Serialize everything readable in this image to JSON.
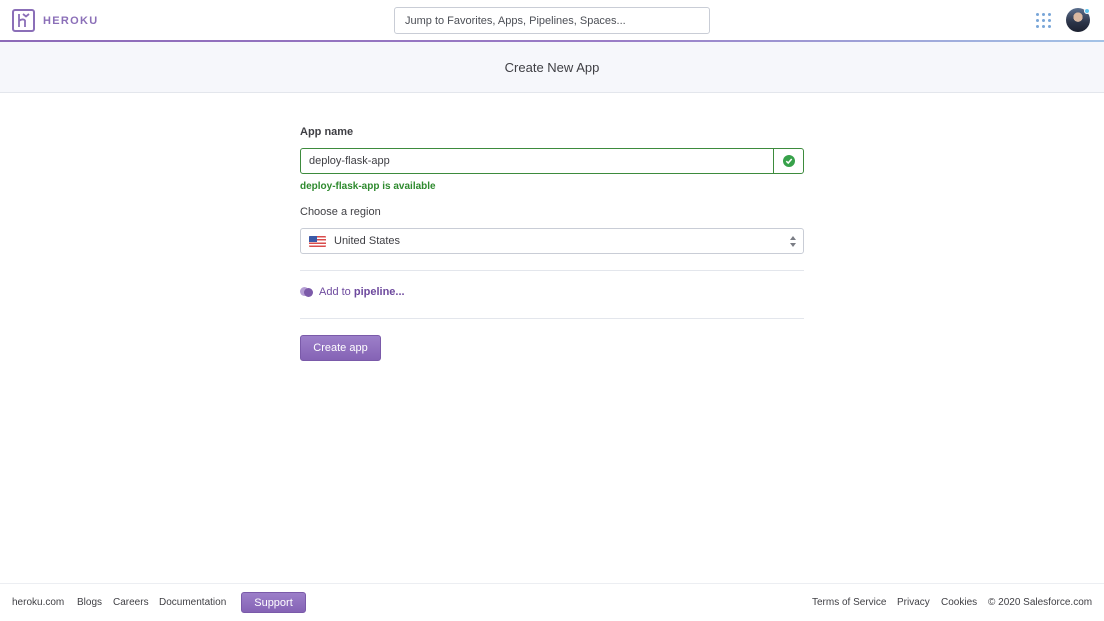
{
  "header": {
    "brand_name": "HEROKU",
    "search_placeholder": "Jump to Favorites, Apps, Pipelines, Spaces..."
  },
  "page": {
    "title": "Create New App"
  },
  "form": {
    "app_name_label": "App name",
    "app_name_value": "deploy-flask-app",
    "availability_message": "deploy-flask-app is available",
    "region_label": "Choose a region",
    "region_value": "United States",
    "pipeline_prefix": "Add to ",
    "pipeline_link": "pipeline...",
    "create_button": "Create app"
  },
  "footer": {
    "links_left": [
      "heroku.com",
      "Blogs",
      "Careers",
      "Documentation"
    ],
    "support_button": "Support",
    "links_right": [
      "Terms of Service",
      "Privacy",
      "Cookies"
    ],
    "copyright": "© 2020 Salesforce.com"
  },
  "colors": {
    "brand": "#8b6fb8",
    "success": "#2e8a2e",
    "accent_blue": "#79a6d8"
  },
  "icons": {
    "logo": "heroku-logo-icon",
    "apps": "apps-grid-icon",
    "valid": "check-circle-icon",
    "flag": "us-flag-icon",
    "pipeline": "pipeline-icon",
    "select": "select-caret-icon"
  }
}
